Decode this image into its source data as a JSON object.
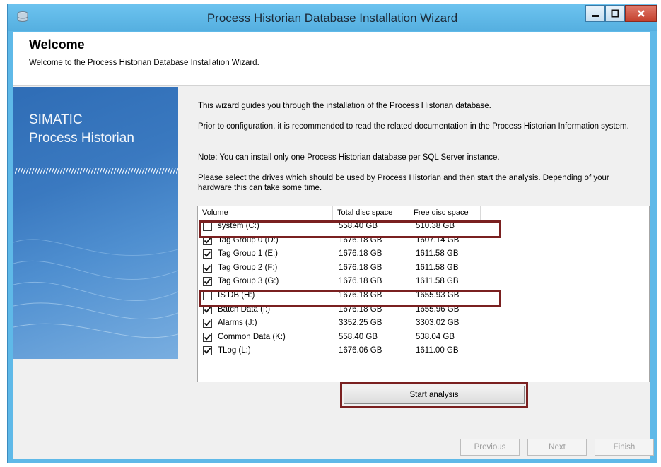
{
  "window": {
    "title": "Process Historian Database Installation Wizard",
    "buttons": {
      "minimize": "▁",
      "maximize": "□",
      "close": "✕"
    }
  },
  "header": {
    "title": "Welcome",
    "subtitle": "Welcome to the Process Historian Database Installation Wizard."
  },
  "brand": {
    "line1": "SIMATIC",
    "line2": "Process Historian",
    "stripes": "///////////////////////////////////"
  },
  "intro": {
    "p1": "This wizard guides you through the installation of the Process Historian database.",
    "p2": "Prior to configuration, it is recommended to read the related documentation in the Process Historian Information system.",
    "p3": "Note: You can install only one Process Historian database per SQL Server instance.",
    "p4": "Please select the drives which should be used by Process Historian and then start the analysis. Depending of your hardware this can take some time."
  },
  "volumes": {
    "headers": [
      "Volume",
      "Total disc space",
      "Free disc space"
    ],
    "rows": [
      {
        "name": "system (C:)",
        "total": "558.40 GB",
        "free": "510.38 GB",
        "checked": false
      },
      {
        "name": "Tag Group 0 (D:)",
        "total": "1676.18 GB",
        "free": "1607.14 GB",
        "checked": true
      },
      {
        "name": "Tag Group 1 (E:)",
        "total": "1676.18 GB",
        "free": "1611.58 GB",
        "checked": true
      },
      {
        "name": "Tag Group 2 (F:)",
        "total": "1676.18 GB",
        "free": "1611.58 GB",
        "checked": true
      },
      {
        "name": "Tag Group 3 (G:)",
        "total": "1676.18 GB",
        "free": "1611.58 GB",
        "checked": true
      },
      {
        "name": "IS DB (H:)",
        "total": "1676.18 GB",
        "free": "1655.93 GB",
        "checked": false
      },
      {
        "name": "Batch Data (I:)",
        "total": "1676.18 GB",
        "free": "1655.96 GB",
        "checked": true
      },
      {
        "name": "Alarms (J:)",
        "total": "3352.25 GB",
        "free": "3303.02 GB",
        "checked": true
      },
      {
        "name": "Common Data (K:)",
        "total": "558.40 GB",
        "free": "538.04 GB",
        "checked": true
      },
      {
        "name": "TLog (L:)",
        "total": "1676.06 GB",
        "free": "1611.00 GB",
        "checked": true
      }
    ]
  },
  "actions": {
    "start_analysis": "Start analysis",
    "previous": "Previous",
    "next": "Next",
    "finish": "Finish"
  },
  "colors": {
    "highlight": "#7a2020",
    "titlebar": "#5fb9e8",
    "brand_panel": "#3a79c0"
  }
}
